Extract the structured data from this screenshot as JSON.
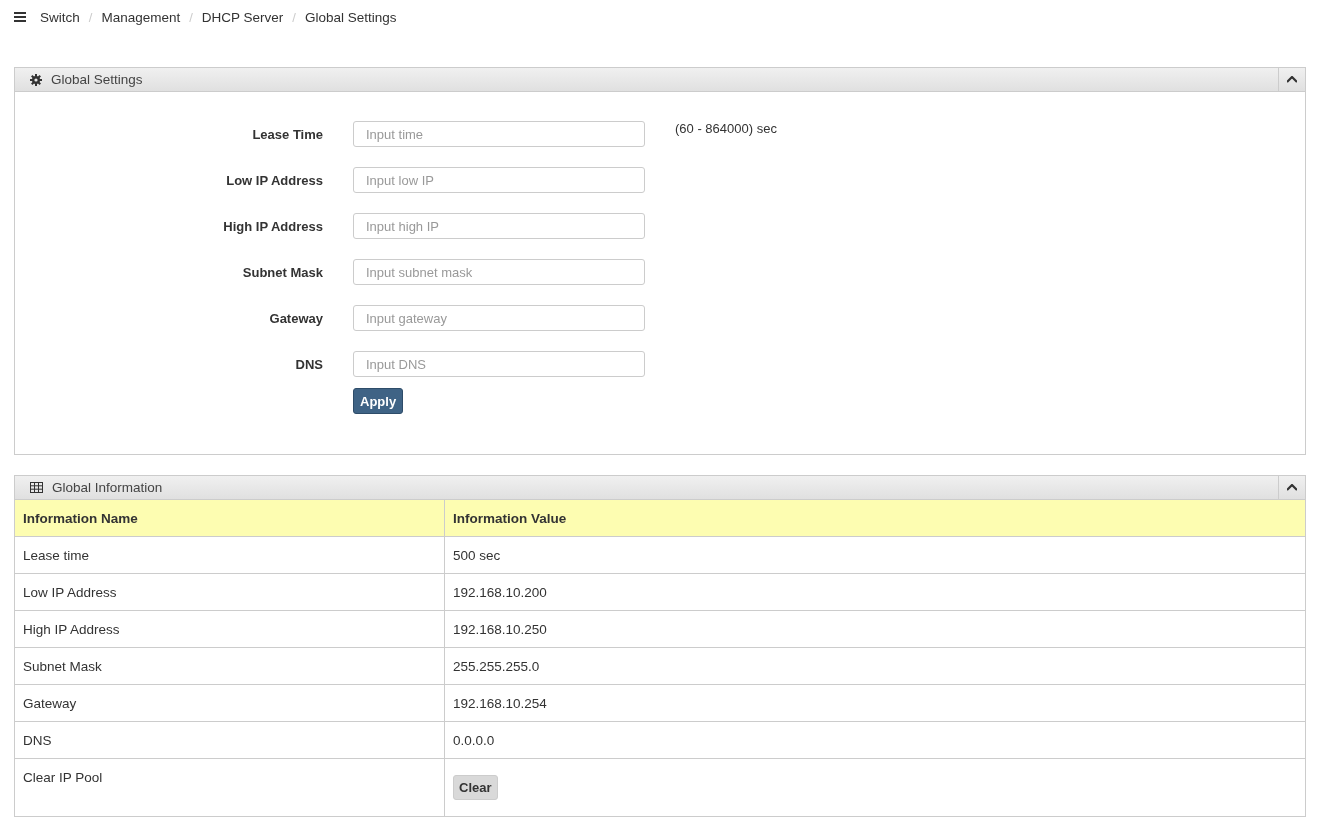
{
  "breadcrumb": [
    "Switch",
    "Management",
    "DHCP Server",
    "Global Settings"
  ],
  "breadcrumb_separator": "/",
  "settings_panel": {
    "title": "Global Settings",
    "fields": [
      {
        "label": "Lease Time",
        "placeholder": "Input time",
        "hint": "(60 - 864000) sec"
      },
      {
        "label": "Low IP Address",
        "placeholder": "Input low IP"
      },
      {
        "label": "High IP Address",
        "placeholder": "Input high IP"
      },
      {
        "label": "Subnet Mask",
        "placeholder": "Input subnet mask"
      },
      {
        "label": "Gateway",
        "placeholder": "Input gateway"
      },
      {
        "label": "DNS",
        "placeholder": "Input DNS"
      }
    ],
    "apply_button": "Apply"
  },
  "info_panel": {
    "title": "Global Information",
    "columns": [
      "Information Name",
      "Information Value"
    ],
    "rows": [
      {
        "kind": "text",
        "name": "Lease time",
        "value": "500 sec"
      },
      {
        "kind": "text",
        "name": "Low IP Address",
        "value": "192.168.10.200"
      },
      {
        "kind": "text",
        "name": "High IP Address",
        "value": "192.168.10.250"
      },
      {
        "kind": "text",
        "name": "Subnet Mask",
        "value": "255.255.255.0"
      },
      {
        "kind": "text",
        "name": "Gateway",
        "value": "192.168.10.254"
      },
      {
        "kind": "text",
        "name": "DNS",
        "value": "0.0.0.0"
      },
      {
        "kind": "button",
        "name": "Clear IP Pool",
        "value": "Clear"
      }
    ]
  }
}
